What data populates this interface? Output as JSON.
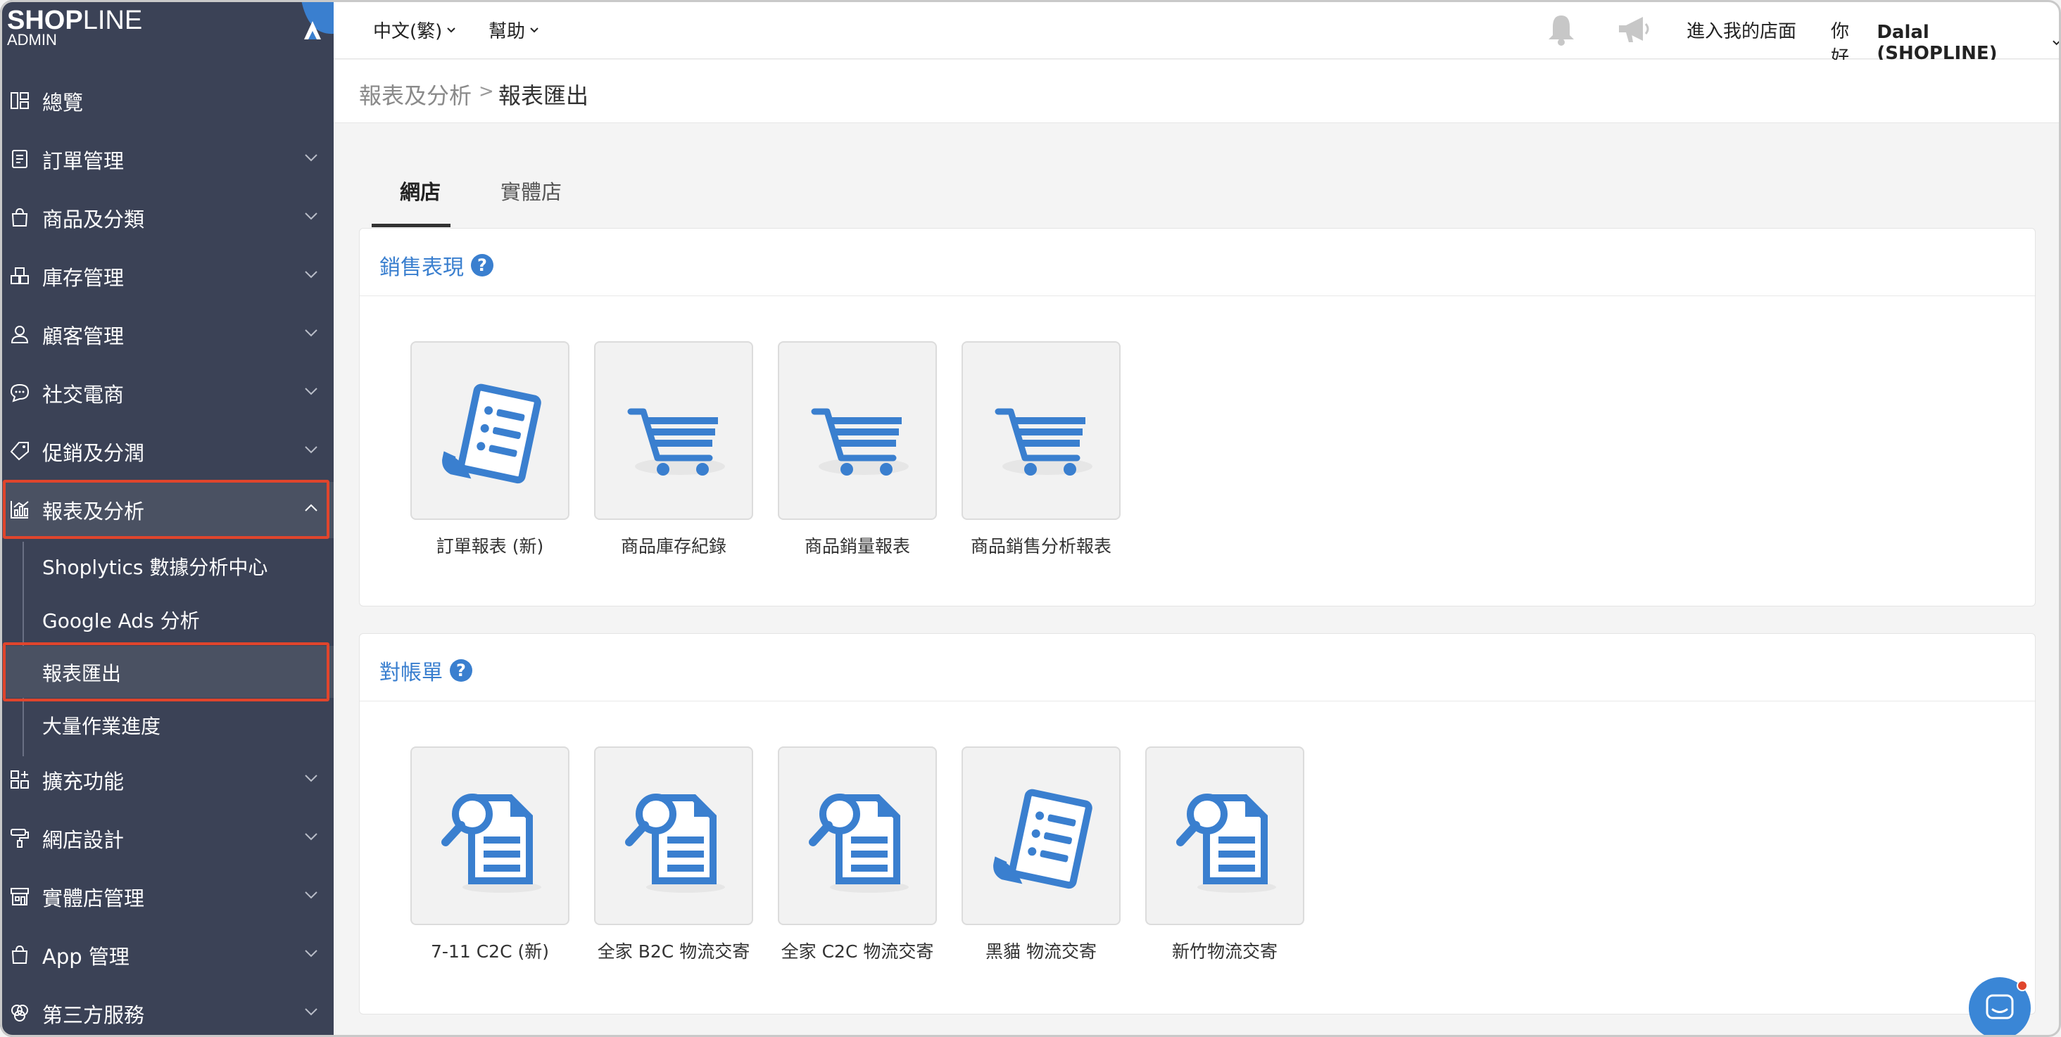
{
  "brand": {
    "name_bold": "SHOP",
    "name_rest": "LINE",
    "sub": "ADMIN",
    "accent": "#3a7fcf",
    "sidebar_bg": "#3b4256"
  },
  "sidebar": {
    "items": [
      {
        "label": "總覽",
        "icon": "dashboard-icon"
      },
      {
        "label": "訂單管理",
        "icon": "order-icon"
      },
      {
        "label": "商品及分類",
        "icon": "bag-icon"
      },
      {
        "label": "庫存管理",
        "icon": "inventory-icon"
      },
      {
        "label": "顧客管理",
        "icon": "user-icon"
      },
      {
        "label": "社交電商",
        "icon": "chat-icon"
      },
      {
        "label": "促銷及分潤",
        "icon": "tag-icon"
      },
      {
        "label": "報表及分析",
        "icon": "chart-icon"
      }
    ],
    "sub_items": [
      {
        "label": "Shoplytics 數據分析中心"
      },
      {
        "label": "Google Ads 分析"
      },
      {
        "label": "報表匯出"
      },
      {
        "label": "大量作業進度"
      }
    ],
    "items_after": [
      {
        "label": "擴充功能",
        "icon": "apps-icon"
      },
      {
        "label": "網店設計",
        "icon": "paint-roller-icon"
      },
      {
        "label": "實體店管理",
        "icon": "store-icon"
      },
      {
        "label": "App 管理",
        "icon": "app-bag-icon"
      },
      {
        "label": "第三方服務",
        "icon": "circles-icon"
      }
    ]
  },
  "topbar": {
    "language": "中文(繁)",
    "help": "幫助",
    "enter_store": "進入我的店面",
    "greeting": "你好, ",
    "user": "Dalal (SHOPLINE)"
  },
  "breadcrumb": {
    "parent": "報表及分析",
    "separator": ">",
    "current": "報表匯出"
  },
  "tabs": [
    {
      "label": "網店",
      "active": true
    },
    {
      "label": "實體店",
      "active": false
    }
  ],
  "sections": [
    {
      "title": "銷售表現",
      "tiles": [
        {
          "label": "訂單報表 (新)",
          "icon": "receipt-icon"
        },
        {
          "label": "商品庫存紀錄",
          "icon": "cart-icon"
        },
        {
          "label": "商品銷量報表",
          "icon": "cart-icon"
        },
        {
          "label": "商品銷售分析報表",
          "icon": "cart-icon"
        }
      ]
    },
    {
      "title": "對帳單",
      "tiles": [
        {
          "label": "7-11 C2C (新)",
          "icon": "document-search-icon"
        },
        {
          "label": "全家 B2C 物流交寄",
          "icon": "document-search-icon"
        },
        {
          "label": "全家 C2C 物流交寄",
          "icon": "document-search-icon"
        },
        {
          "label": "黑貓 物流交寄",
          "icon": "receipt-icon"
        },
        {
          "label": "新竹物流交寄",
          "icon": "document-search-icon"
        }
      ]
    }
  ],
  "help_glyph": "?"
}
